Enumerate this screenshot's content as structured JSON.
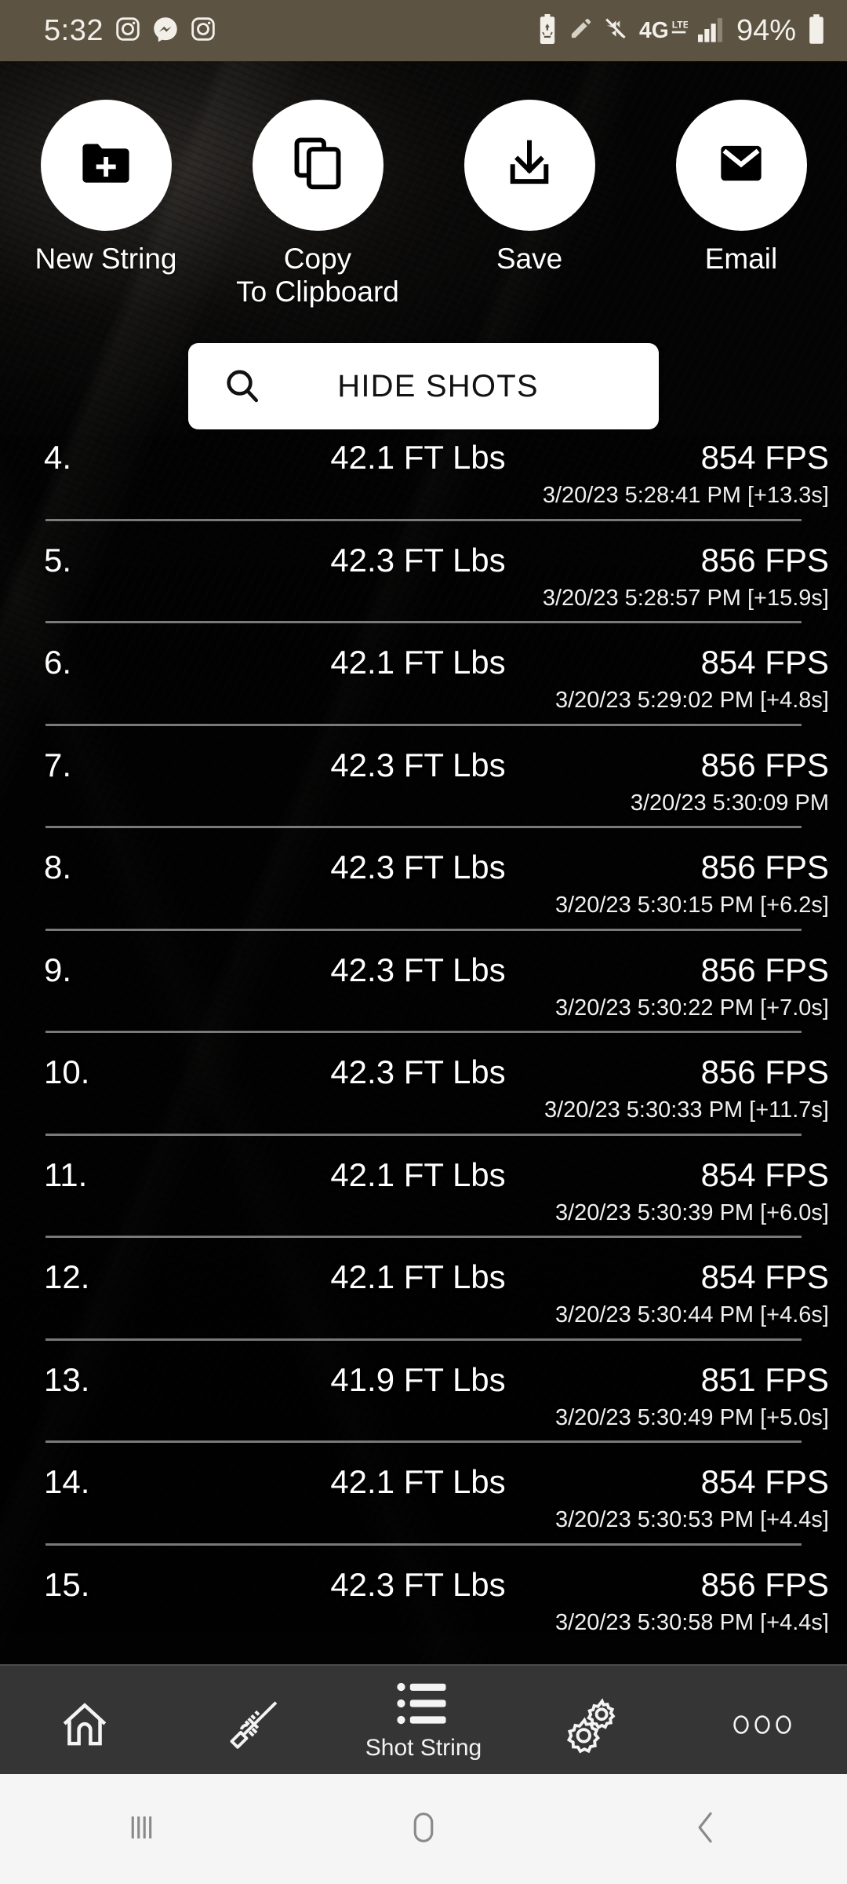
{
  "statusbar": {
    "time": "5:32",
    "battery_percent": "94%",
    "network": "4G",
    "network_sub": "LTE",
    "left_icons": [
      "instagram-icon",
      "messenger-icon",
      "instagram-icon"
    ],
    "right_icons": [
      "battery-saver-icon",
      "pencil-icon",
      "mute-icon",
      "4glte-icon",
      "signal-bars-icon",
      "battery-icon"
    ],
    "bg_color": "#5c5343"
  },
  "actions": [
    {
      "label": "New String",
      "icon": "new-folder-icon"
    },
    {
      "label": "Copy\nTo Clipboard",
      "icon": "copy-icon"
    },
    {
      "label": "Save",
      "icon": "download-icon"
    },
    {
      "label": "Email",
      "icon": "envelope-icon"
    }
  ],
  "search": {
    "label": "HIDE SHOTS",
    "icon": "search-icon"
  },
  "shot_list": {
    "columns": [
      "index",
      "energy",
      "speed",
      "timestamp"
    ],
    "rows": [
      {
        "index": "4.",
        "energy": "42.1 FT Lbs",
        "speed": "854 FPS",
        "timestamp": "3/20/23 5:28:41 PM [+13.3s]"
      },
      {
        "index": "5.",
        "energy": "42.3 FT Lbs",
        "speed": "856 FPS",
        "timestamp": "3/20/23 5:28:57 PM [+15.9s]"
      },
      {
        "index": "6.",
        "energy": "42.1 FT Lbs",
        "speed": "854 FPS",
        "timestamp": "3/20/23 5:29:02 PM [+4.8s]"
      },
      {
        "index": "7.",
        "energy": "42.3 FT Lbs",
        "speed": "856 FPS",
        "timestamp": "3/20/23 5:30:09 PM"
      },
      {
        "index": "8.",
        "energy": "42.3 FT Lbs",
        "speed": "856 FPS",
        "timestamp": "3/20/23 5:30:15 PM [+6.2s]"
      },
      {
        "index": "9.",
        "energy": "42.3 FT Lbs",
        "speed": "856 FPS",
        "timestamp": "3/20/23 5:30:22 PM [+7.0s]"
      },
      {
        "index": "10.",
        "energy": "42.3 FT Lbs",
        "speed": "856 FPS",
        "timestamp": "3/20/23 5:30:33 PM [+11.7s]"
      },
      {
        "index": "11.",
        "energy": "42.1 FT Lbs",
        "speed": "854 FPS",
        "timestamp": "3/20/23 5:30:39 PM [+6.0s]"
      },
      {
        "index": "12.",
        "energy": "42.1 FT Lbs",
        "speed": "854 FPS",
        "timestamp": "3/20/23 5:30:44 PM [+4.6s]"
      },
      {
        "index": "13.",
        "energy": "41.9 FT Lbs",
        "speed": "851 FPS",
        "timestamp": "3/20/23 5:30:49 PM [+5.0s]"
      },
      {
        "index": "14.",
        "energy": "42.1 FT Lbs",
        "speed": "854 FPS",
        "timestamp": "3/20/23 5:30:53 PM [+4.4s]"
      },
      {
        "index": "15.",
        "energy": "42.3 FT Lbs",
        "speed": "856 FPS",
        "timestamp": "3/20/23 5:30:58 PM [+4.4s]"
      }
    ]
  },
  "bottom_nav": {
    "background": "#353535",
    "items": [
      {
        "icon": "home-icon",
        "label": ""
      },
      {
        "icon": "rifle-icon",
        "label": ""
      },
      {
        "icon": "list-icon",
        "label": "Shot String"
      },
      {
        "icon": "gears-icon",
        "label": ""
      },
      {
        "icon": "more-dots-icon",
        "label": ""
      }
    ]
  },
  "system_nav": {
    "background": "#f5f5f5",
    "items": [
      {
        "icon": "recents-icon"
      },
      {
        "icon": "home-button-icon"
      },
      {
        "icon": "back-icon"
      }
    ]
  }
}
